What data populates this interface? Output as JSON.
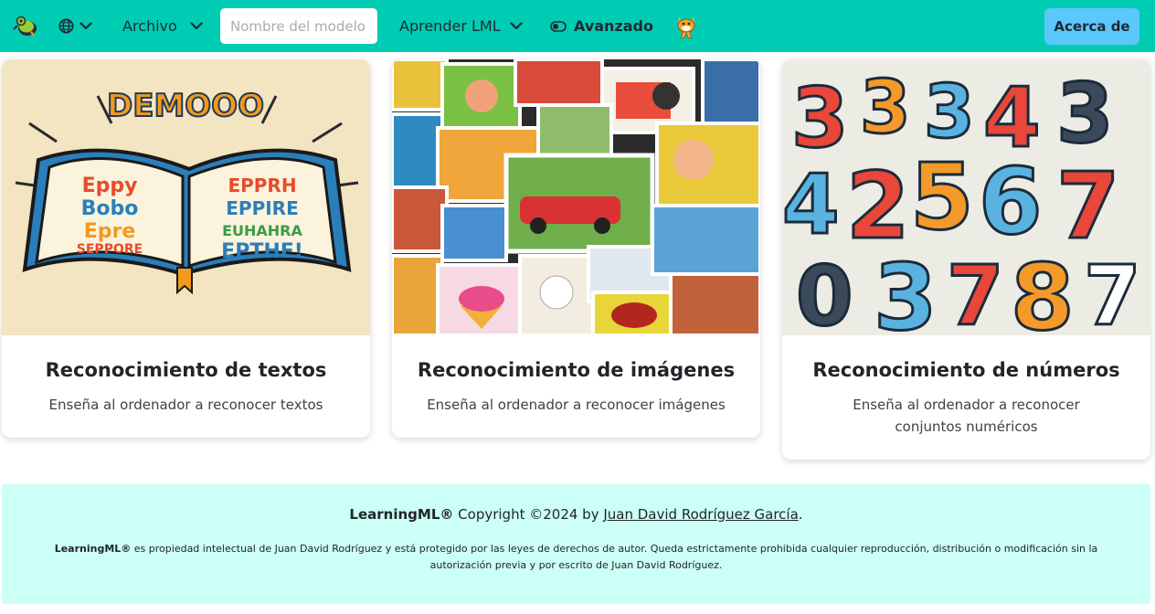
{
  "navbar": {
    "logo_icon": "learningml-logo-icon",
    "language_icon": "globe-icon",
    "archivo_label": "Archivo",
    "model_name_placeholder": "Nombre del modelo",
    "aprender_label": "Aprender LML",
    "avanzado_label": "Avanzado",
    "scratch_icon": "scratch-cat-icon",
    "about_label": "Acerca de",
    "accent_color": "#00ccb3",
    "about_color": "#5ac8fa"
  },
  "cards": [
    {
      "image_icon": "open-book-letters-illustration",
      "title": "Reconocimiento de textos",
      "text": "Enseña al ordenador a reconocer textos"
    },
    {
      "image_icon": "photo-collage-illustration",
      "title": "Reconocimiento de imágenes",
      "text": "Enseña al ordenador a reconocer imágenes"
    },
    {
      "image_icon": "colorful-numbers-illustration",
      "title": "Reconocimiento de números",
      "text": "Enseña al ordenador a reconocer conjuntos numéricos"
    }
  ],
  "footer": {
    "brand": "LearningML®",
    "copyright_text": " Copyright ©2024 by ",
    "author_link": "Juan David Rodríguez García",
    "period": ".",
    "legal_brand": "LearningML®",
    "legal_text": " es propiedad intelectual de Juan David Rodríguez y está protegido por las leyes de derechos de autor. Queda estrictamente prohibida cualquier reproducción, distribución o modificación sin la autorización previa y por escrito de Juan David Rodríguez.",
    "background_color": "#ccfff5"
  }
}
